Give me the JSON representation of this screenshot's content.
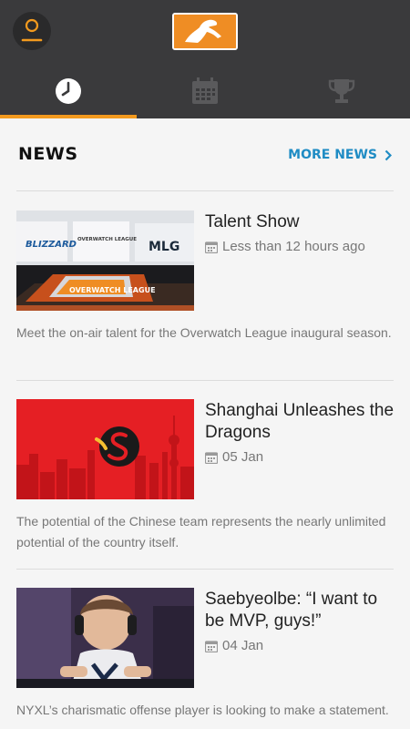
{
  "header": {
    "profile_icon": "user-icon",
    "logo_icon": "overwatch-league-logo",
    "tabs": [
      {
        "name": "schedule",
        "icon": "clock-icon",
        "active": true
      },
      {
        "name": "calendar",
        "icon": "calendar-icon",
        "active": false
      },
      {
        "name": "standings",
        "icon": "trophy-icon",
        "active": false
      }
    ],
    "accent_color": "#f39a1e"
  },
  "news": {
    "title": "NEWS",
    "more_label": "MORE NEWS",
    "link_color": "#1f8cc4",
    "articles": [
      {
        "title": "Talent Show",
        "date": "Less than 12 hours ago",
        "description": "Meet the on-air talent for the Overwatch League inaugural season.",
        "thumb_labels": [
          "BLIZZARD",
          "OVERWATCH LEAGUE",
          "MLG"
        ],
        "thumb_brand": "OVERWATCH LEAGUE"
      },
      {
        "title": "Shanghai Unleashes the Dragons",
        "date": "05 Jan",
        "description": "The potential of the Chinese team represents the nearly unlimited potential of the country itself."
      },
      {
        "title": "Saebyeolbe: “I want to be MVP, guys!”",
        "date": "04 Jan",
        "description": "NYXL’s charismatic offense player is looking to make a statement."
      }
    ]
  }
}
